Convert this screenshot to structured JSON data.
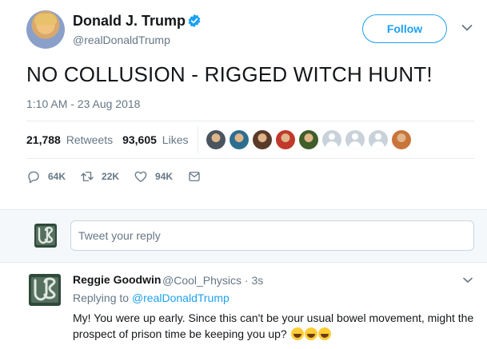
{
  "tweet": {
    "display_name": "Donald J. Trump",
    "handle": "@realDonaldTrump",
    "follow_label": "Follow",
    "text": "NO COLLUSION - RIGGED WITCH HUNT!",
    "timestamp": "1:10 AM - 23 Aug 2018",
    "stats": {
      "retweets_count": "21,788",
      "retweets_label": "Retweets",
      "likes_count": "93,605",
      "likes_label": "Likes"
    },
    "likers": [
      {
        "kind": "photo",
        "color": "#4a5560"
      },
      {
        "kind": "photo",
        "color": "#2c6e8f"
      },
      {
        "kind": "photo",
        "color": "#5a3b2a"
      },
      {
        "kind": "photo",
        "color": "#c0392b"
      },
      {
        "kind": "photo",
        "color": "#3f5e2a"
      },
      {
        "kind": "default"
      },
      {
        "kind": "default"
      },
      {
        "kind": "default"
      },
      {
        "kind": "photo",
        "color": "#c8743a"
      }
    ],
    "actions": {
      "replies": "64K",
      "retweets": "22K",
      "likes": "94K"
    }
  },
  "reply_box": {
    "placeholder": "Tweet your reply"
  },
  "comment": {
    "name": "Reggie Goodwin",
    "handle_time": "@Cool_Physics · 3s",
    "replying_prefix": "Replying to",
    "replying_to": "@realDonaldTrump",
    "text": "My! You were up early. Since this can't be your usual bowel movement, might the prospect of prison time be keeping you up?",
    "emoji_count": 3
  },
  "colors": {
    "accent": "#1da1f2",
    "muted": "#657786",
    "text": "#14171a",
    "verified": "#1da1f2"
  },
  "icons": [
    "verified-badge-icon",
    "chevron-down-icon",
    "reply-icon",
    "retweet-icon",
    "heart-icon",
    "message-icon",
    "avatar-icon",
    "rolling-laughing-emoji"
  ]
}
